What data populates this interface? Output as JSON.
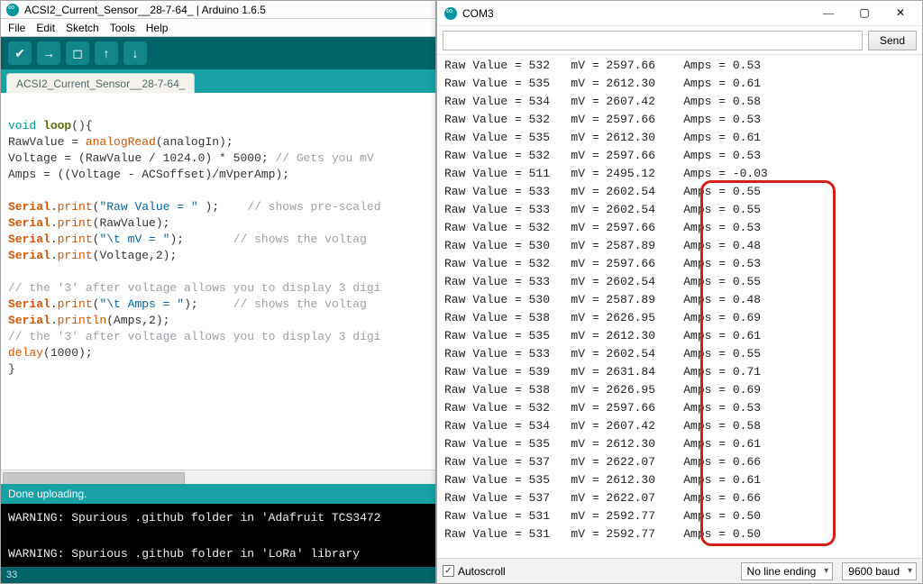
{
  "ide": {
    "title": "ACSI2_Current_Sensor__28-7-64_ | Arduino 1.6.5",
    "menu": [
      "File",
      "Edit",
      "Sketch",
      "Tools",
      "Help"
    ],
    "tab_label": "ACSI2_Current_Sensor__28-7-64_",
    "code_lines": [
      {
        "t": "blank"
      },
      {
        "t": "raw",
        "tokens": [
          [
            "void",
            "kw-void"
          ],
          [
            " ",
            ""
          ],
          [
            "loop",
            "kw-func"
          ],
          [
            "(){",
            ""
          ]
        ]
      },
      {
        "t": "raw",
        "tokens": [
          [
            "RawValue = ",
            ""
          ],
          [
            "analogRead",
            "kw-call"
          ],
          [
            "(analogIn);",
            ""
          ]
        ]
      },
      {
        "t": "raw",
        "tokens": [
          [
            "Voltage = (RawValue / 1024.0) * 5000; ",
            ""
          ],
          [
            "// Gets you mV",
            "comment"
          ]
        ]
      },
      {
        "t": "raw",
        "tokens": [
          [
            "Amps = ((Voltage - ACSoffset)/mVperAmp);",
            ""
          ]
        ]
      },
      {
        "t": "blank"
      },
      {
        "t": "raw",
        "tokens": [
          [
            "Serial",
            "kw-class"
          ],
          [
            ".",
            ""
          ],
          [
            "print",
            "kw-method"
          ],
          [
            "(",
            ""
          ],
          [
            "\"Raw Value = \"",
            "str"
          ],
          [
            " );    ",
            ""
          ],
          [
            "// shows pre-scaled",
            "comment"
          ]
        ]
      },
      {
        "t": "raw",
        "tokens": [
          [
            "Serial",
            "kw-class"
          ],
          [
            ".",
            ""
          ],
          [
            "print",
            "kw-method"
          ],
          [
            "(RawValue);",
            ""
          ]
        ]
      },
      {
        "t": "raw",
        "tokens": [
          [
            "Serial",
            "kw-class"
          ],
          [
            ".",
            ""
          ],
          [
            "print",
            "kw-method"
          ],
          [
            "(",
            ""
          ],
          [
            "\"\\t mV = \"",
            "str"
          ],
          [
            ");       ",
            ""
          ],
          [
            "// shows the voltag",
            "comment"
          ]
        ]
      },
      {
        "t": "raw",
        "tokens": [
          [
            "Serial",
            "kw-class"
          ],
          [
            ".",
            ""
          ],
          [
            "print",
            "kw-method"
          ],
          [
            "(Voltage,2);",
            ""
          ]
        ]
      },
      {
        "t": "blank"
      },
      {
        "t": "raw",
        "tokens": [
          [
            "// the '3' after voltage allows you to display 3 digi",
            "comment"
          ]
        ]
      },
      {
        "t": "raw",
        "tokens": [
          [
            "Serial",
            "kw-class"
          ],
          [
            ".",
            ""
          ],
          [
            "print",
            "kw-method"
          ],
          [
            "(",
            ""
          ],
          [
            "\"\\t Amps = \"",
            "str"
          ],
          [
            ");     ",
            ""
          ],
          [
            "// shows the voltag",
            "comment"
          ]
        ]
      },
      {
        "t": "raw",
        "tokens": [
          [
            "Serial",
            "kw-class"
          ],
          [
            ".",
            ""
          ],
          [
            "println",
            "kw-method"
          ],
          [
            "(Amps,2);",
            ""
          ]
        ]
      },
      {
        "t": "raw",
        "tokens": [
          [
            "// the '3' after voltage allows you to display 3 digi",
            "comment"
          ]
        ]
      },
      {
        "t": "raw",
        "tokens": [
          [
            "delay",
            "kw-call"
          ],
          [
            "(1000);",
            ""
          ]
        ]
      },
      {
        "t": "raw",
        "tokens": [
          [
            "}",
            ""
          ]
        ]
      }
    ],
    "status": "Done uploading.",
    "console_lines": [
      "WARNING: Spurious .github folder in 'Adafruit TCS3472",
      "",
      "WARNING: Spurious .github folder in 'LoRa' library"
    ],
    "footer": "33"
  },
  "serial": {
    "title": "COM3",
    "send_label": "Send",
    "autoscroll_label": "Autoscroll",
    "autoscroll_checked": true,
    "line_ending": "No line ending",
    "baud": "9600 baud",
    "rows": [
      {
        "raw": "532",
        "mv": "2597.66",
        "amps": "0.53"
      },
      {
        "raw": "535",
        "mv": "2612.30",
        "amps": "0.61"
      },
      {
        "raw": "534",
        "mv": "2607.42",
        "amps": "0.58"
      },
      {
        "raw": "532",
        "mv": "2597.66",
        "amps": "0.53"
      },
      {
        "raw": "535",
        "mv": "2612.30",
        "amps": "0.61"
      },
      {
        "raw": "532",
        "mv": "2597.66",
        "amps": "0.53"
      },
      {
        "raw": "511",
        "mv": "2495.12",
        "amps": "-0.03"
      },
      {
        "raw": "533",
        "mv": "2602.54",
        "amps": "0.55"
      },
      {
        "raw": "533",
        "mv": "2602.54",
        "amps": "0.55"
      },
      {
        "raw": "532",
        "mv": "2597.66",
        "amps": "0.53"
      },
      {
        "raw": "530",
        "mv": "2587.89",
        "amps": "0.48"
      },
      {
        "raw": "532",
        "mv": "2597.66",
        "amps": "0.53"
      },
      {
        "raw": "533",
        "mv": "2602.54",
        "amps": "0.55"
      },
      {
        "raw": "530",
        "mv": "2587.89",
        "amps": "0.48"
      },
      {
        "raw": "538",
        "mv": "2626.95",
        "amps": "0.69"
      },
      {
        "raw": "535",
        "mv": "2612.30",
        "amps": "0.61"
      },
      {
        "raw": "533",
        "mv": "2602.54",
        "amps": "0.55"
      },
      {
        "raw": "539",
        "mv": "2631.84",
        "amps": "0.71"
      },
      {
        "raw": "538",
        "mv": "2626.95",
        "amps": "0.69"
      },
      {
        "raw": "532",
        "mv": "2597.66",
        "amps": "0.53"
      },
      {
        "raw": "534",
        "mv": "2607.42",
        "amps": "0.58"
      },
      {
        "raw": "535",
        "mv": "2612.30",
        "amps": "0.61"
      },
      {
        "raw": "537",
        "mv": "2622.07",
        "amps": "0.66"
      },
      {
        "raw": "535",
        "mv": "2612.30",
        "amps": "0.61"
      },
      {
        "raw": "537",
        "mv": "2622.07",
        "amps": "0.66"
      },
      {
        "raw": "531",
        "mv": "2592.77",
        "amps": "0.50"
      },
      {
        "raw": "531",
        "mv": "2592.77",
        "amps": "0.50"
      }
    ],
    "highlight": {
      "first_row_index": 7,
      "last_row_index": 26
    }
  }
}
